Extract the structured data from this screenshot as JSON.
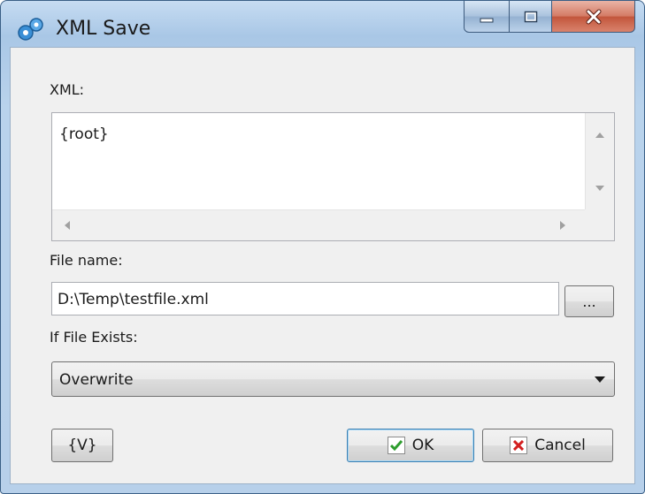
{
  "window": {
    "title": "XML Save"
  },
  "xml_field": {
    "label": "XML:",
    "value": "{root}"
  },
  "file_name": {
    "label": "File name:",
    "value": "D:\\Temp\\testfile.xml",
    "browse_label": "..."
  },
  "if_file_exists": {
    "label": "If File Exists:",
    "selected": "Overwrite"
  },
  "buttons": {
    "variables_label": "{V}",
    "ok_label": "OK",
    "cancel_label": "Cancel"
  },
  "colors": {
    "ok_check": "#2e9d2e",
    "cancel_x": "#d32020",
    "close_button": "#c2553b"
  },
  "icons": {
    "app": "gears-icon",
    "minimize": "minimize-icon",
    "maximize": "maximize-icon",
    "close": "close-icon",
    "ok": "checkmark-icon",
    "cancel": "x-icon"
  }
}
